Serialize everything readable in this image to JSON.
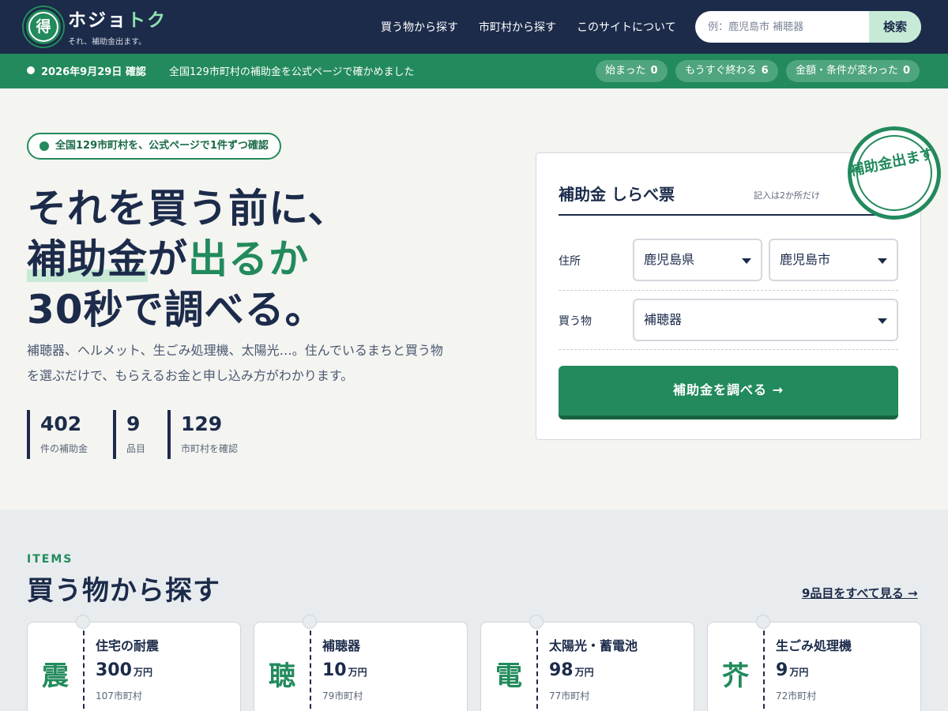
{
  "header": {
    "logo_glyph": "得",
    "title_main": "ホジョ",
    "title_accent": "トク",
    "tagline": "それ、補助金出ます。",
    "nav": [
      "買う物から探す",
      "市町村から探す",
      "このサイトについて"
    ],
    "search_placeholder": "例：鹿児島市 補聴器",
    "search_button": "検索"
  },
  "status": {
    "date": "2026年9月29日 確認",
    "message": "全国129市町村の補助金を公式ページで確かめました",
    "pills": [
      {
        "label": "始まった",
        "count": "0"
      },
      {
        "label": "もうすぐ終わる",
        "count": "6"
      },
      {
        "label": "金額・条件が変わった",
        "count": "0"
      }
    ]
  },
  "hero": {
    "badge": "全国129市町村を、公式ページで1件ずつ確認",
    "line1": "それを買う前に、",
    "line2_mark": "補助金",
    "line2_mid": "が",
    "line2_green": "出るか",
    "line3": "30秒で調べる。",
    "lead": "補聴器、ヘルメット、生ごみ処理機、太陽光…。住んでいるまちと買う物を選ぶだけで、もらえるお金と申し込み方がわかります。",
    "stats": [
      {
        "num": "402",
        "label": "件の補助金"
      },
      {
        "num": "9",
        "label": "品目"
      },
      {
        "num": "129",
        "label": "市町村を確認"
      }
    ]
  },
  "form": {
    "title": "補助金 しらべ票",
    "note": "記入は2か所だけ",
    "address_label": "住所",
    "prefecture": "鹿児島県",
    "city": "鹿児島市",
    "item_label": "買う物",
    "item": "補聴器",
    "submit": "補助金を調べる →",
    "stamp": "補助金出ます"
  },
  "items": {
    "eyebrow": "ITEMS",
    "title": "買う物から探す",
    "see_all": "9品目をすべて見る →",
    "cards": [
      {
        "glyph": "震",
        "name": "住宅の耐震",
        "amount": "300",
        "unit": "万円",
        "munis": "107市町村"
      },
      {
        "glyph": "聴",
        "name": "補聴器",
        "amount": "10",
        "unit": "万円",
        "munis": "79市町村"
      },
      {
        "glyph": "電",
        "name": "太陽光・蓄電池",
        "amount": "98",
        "unit": "万円",
        "munis": "77市町村"
      },
      {
        "glyph": "芥",
        "name": "生ごみ処理機",
        "amount": "9",
        "unit": "万円",
        "munis": "72市町村"
      }
    ]
  }
}
